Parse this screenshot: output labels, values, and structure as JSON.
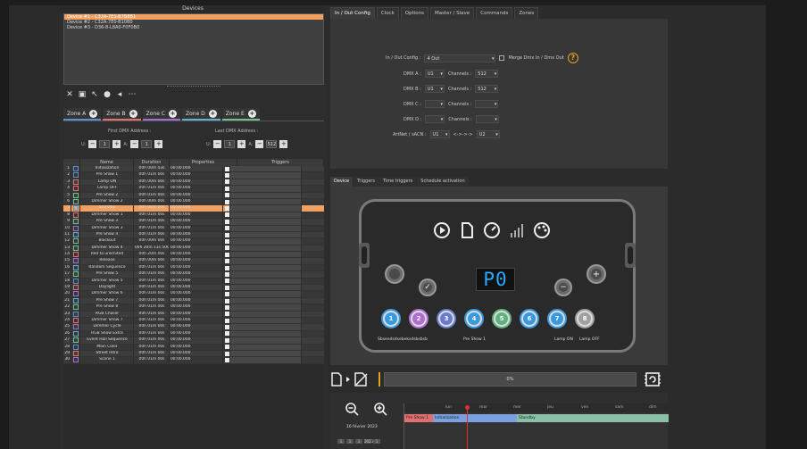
{
  "devices": {
    "title": "Devices",
    "items": [
      {
        "label": "Device #1 - C32A-7E1-B7B8B1",
        "selected": true
      },
      {
        "label": "Device #2 - C32A-7E0-B10B0",
        "selected": false
      },
      {
        "label": "Device #3 - D36-8-L8A0-F0F0B0",
        "selected": false
      }
    ]
  },
  "zones": [
    {
      "label": "Zone A",
      "color": "#5a8fd0"
    },
    {
      "label": "Zone B",
      "color": "#e07070"
    },
    {
      "label": "Zone C",
      "color": "#a070d0"
    },
    {
      "label": "Zone D",
      "color": "#60b0d0"
    },
    {
      "label": "Zone E",
      "color": "#70c090"
    }
  ],
  "dmx": {
    "first_label": "First DMX Address :",
    "last_label": "Last DMX Address :",
    "first_u": "U:",
    "first_u_val": "1",
    "first_a": "A:",
    "first_a_val": "1",
    "last_u": "U:",
    "last_u_val": "1",
    "last_a": "A:",
    "last_a_val": "512"
  },
  "grid": {
    "headers": [
      "Name",
      "Duration",
      "Properties",
      "Triggers"
    ],
    "rows": [
      {
        "n": "1",
        "name": "Initialization",
        "dur": "00h 00m 03s",
        "prop": "00:00.000",
        "c": "#5a8fd0"
      },
      {
        "n": "2",
        "name": "Pre Show 1",
        "dur": "00h 01m 00s",
        "prop": "00:00.000",
        "c": "#5a8fd0"
      },
      {
        "n": "3",
        "name": "Lamp ON",
        "dur": "00h 00m 00s",
        "prop": "00:00.000",
        "c": "#e07070"
      },
      {
        "n": "4",
        "name": "Lamp OFF",
        "dur": "00h 01m 00s",
        "prop": "00:00.000",
        "c": "#e07070"
      },
      {
        "n": "5",
        "name": "Pre Show 2",
        "dur": "00h 01m 00s",
        "prop": "00:00.000",
        "c": "#70c090"
      },
      {
        "n": "6",
        "name": "Dimmer Show 2",
        "dur": "00h 00m 00s",
        "prop": "00:00.000",
        "c": "#70c090"
      },
      {
        "n": "7",
        "name": "Standby",
        "dur": "00h 00m 00s",
        "prop": "00:00.000",
        "c": "#5a8fd0",
        "sel": true
      },
      {
        "n": "8",
        "name": "Dimmer Show 1",
        "dur": "00h 01m 00s",
        "prop": "00:00.000",
        "c": "#e07070"
      },
      {
        "n": "9",
        "name": "Pre Show 3",
        "dur": "00h 01m 00s",
        "prop": "00:00.000",
        "c": "#70c090"
      },
      {
        "n": "10",
        "name": "Dimmer Show 3",
        "dur": "00h 01m 00s",
        "prop": "00:00.000",
        "c": "#a070d0"
      },
      {
        "n": "11",
        "name": "Pre Show 4",
        "dur": "00h 01m 00s",
        "prop": "00:00.000",
        "c": "#60b0d0"
      },
      {
        "n": "12",
        "name": "Blackout",
        "dur": "00h 00m 00s",
        "prop": "00:00.000",
        "c": "#70c090"
      },
      {
        "n": "13",
        "name": "Dimmer Show 4",
        "dur": "00h 20m 11s 500",
        "prop": "00:00.000",
        "c": "#70c090"
      },
      {
        "n": "14",
        "name": "Red to unlimited",
        "dur": "00h 20m 00s",
        "prop": "00:00.000",
        "c": "#e07070"
      },
      {
        "n": "15",
        "name": "Release",
        "dur": "00h 00m 00s",
        "prop": "00:00.000",
        "c": "#a070d0"
      },
      {
        "n": "16",
        "name": "Random Sequence",
        "dur": "00h 01m 00s",
        "prop": "00:00.000",
        "c": "#60b0d0"
      },
      {
        "n": "17",
        "name": "Pre Show 5",
        "dur": "00h 01m 00s",
        "prop": "00:00.000",
        "c": "#70c090"
      },
      {
        "n": "18",
        "name": "Dimmer Show 5",
        "dur": "00h 01m 00s",
        "prop": "00:00.000",
        "c": "#5a8fd0"
      },
      {
        "n": "19",
        "name": "Daylight",
        "dur": "00h 01m 00s",
        "prop": "00:00.000",
        "c": "#e07070"
      },
      {
        "n": "20",
        "name": "Dimmer Show 6",
        "dur": "00h 01m 00s",
        "prop": "00:00.000",
        "c": "#a070d0"
      },
      {
        "n": "21",
        "name": "Pre Show 7",
        "dur": "00h 01m 00s",
        "prop": "00:00.000",
        "c": "#60b0d0"
      },
      {
        "n": "22",
        "name": "Pre Show 8",
        "dur": "00h 01m 00s",
        "prop": "00:00.000",
        "c": "#70c090"
      },
      {
        "n": "23",
        "name": "RGB Chaser",
        "dur": "00h 01m 00s",
        "prop": "00:00.000",
        "c": "#5a8fd0"
      },
      {
        "n": "24",
        "name": "Dimmer Show 7",
        "dur": "00h 01m 00s",
        "prop": "00:00.000",
        "c": "#e07070"
      },
      {
        "n": "25",
        "name": "Dimmer Cycle",
        "dur": "00h 01m 00s",
        "prop": "00:00.000",
        "c": "#a070d0"
      },
      {
        "n": "26",
        "name": "RGB Show Extra",
        "dur": "00h 01m 00s",
        "prop": "00:00.000",
        "c": "#60b0d0"
      },
      {
        "n": "27",
        "name": "Event Hall Sequence",
        "dur": "00h 01m 00s",
        "prop": "00:00.000",
        "c": "#70c090"
      },
      {
        "n": "28",
        "name": "Main Color",
        "dur": "00h 01m 00s",
        "prop": "00:00.000",
        "c": "#5a8fd0"
      },
      {
        "n": "29",
        "name": "Street Intro",
        "dur": "00h 01m 00s",
        "prop": "00:00.000",
        "c": "#e07070"
      },
      {
        "n": "30",
        "name": "Scene 1",
        "dur": "00h 01m 00s",
        "prop": "00:00.000",
        "c": "#a070d0"
      }
    ]
  },
  "tabs": [
    "In / Out Config",
    "Clock",
    "Options",
    "Master / Slave",
    "Commands",
    "Zones"
  ],
  "config": {
    "io_label": "In / Out Config :",
    "io_value": "4 Out",
    "merge_label": "Merge Dmx In / Dmx Out",
    "help": "?",
    "rows": [
      {
        "label": "DMX A :",
        "u": "U1",
        "ch_label": "Channels :",
        "ch": "512"
      },
      {
        "label": "DMX B :",
        "u": "U1",
        "ch_label": "Channels :",
        "ch": "512"
      },
      {
        "label": "DMX C :",
        "u": "",
        "ch_label": "Channels :",
        "ch": ""
      },
      {
        "label": "DMX D :",
        "u": "",
        "ch_label": "Channels :",
        "ch": ""
      },
      {
        "label": "ArtNet / sACN :",
        "u": "U1",
        "ch_label": "<->->->",
        "ch": "U2"
      }
    ]
  },
  "sub_tabs": [
    "Device",
    "Triggers",
    "Time triggers",
    "Schedule activation"
  ],
  "device": {
    "display": "P0",
    "buttons": [
      {
        "n": "1",
        "color": "#3a9ae0"
      },
      {
        "n": "2",
        "color": "#b070d0"
      },
      {
        "n": "3",
        "color": "#6a7acc"
      },
      {
        "n": "4",
        "color": "#3a9ae0"
      },
      {
        "n": "5",
        "color": "#60b080"
      },
      {
        "n": "6",
        "color": "#3a9ae0"
      },
      {
        "n": "7",
        "color": "#3a9ae0"
      },
      {
        "n": "8",
        "color": "#a0a0a0"
      }
    ],
    "labels": [
      "Sbseedsdsebeksdsbsbsb",
      "Pre Show 1",
      "Lamp ON",
      "Lamp OFF"
    ]
  },
  "upload": {
    "progress_text": "0%",
    "progress": 0
  },
  "timeline": {
    "date": "16 février 2023",
    "ruler": [
      "lun",
      "mar",
      "mer",
      "jeu",
      "ven",
      "sam",
      "dim"
    ],
    "blocks": [
      {
        "label": "Pre Show 1",
        "color": "#e07070"
      },
      {
        "label": "Initialization",
        "color": "#7aa0e0"
      },
      {
        "label": "Standby",
        "color": "#8ac0a8"
      }
    ],
    "mini": [
      "1",
      "1",
      "1",
      "2023",
      "1"
    ]
  }
}
